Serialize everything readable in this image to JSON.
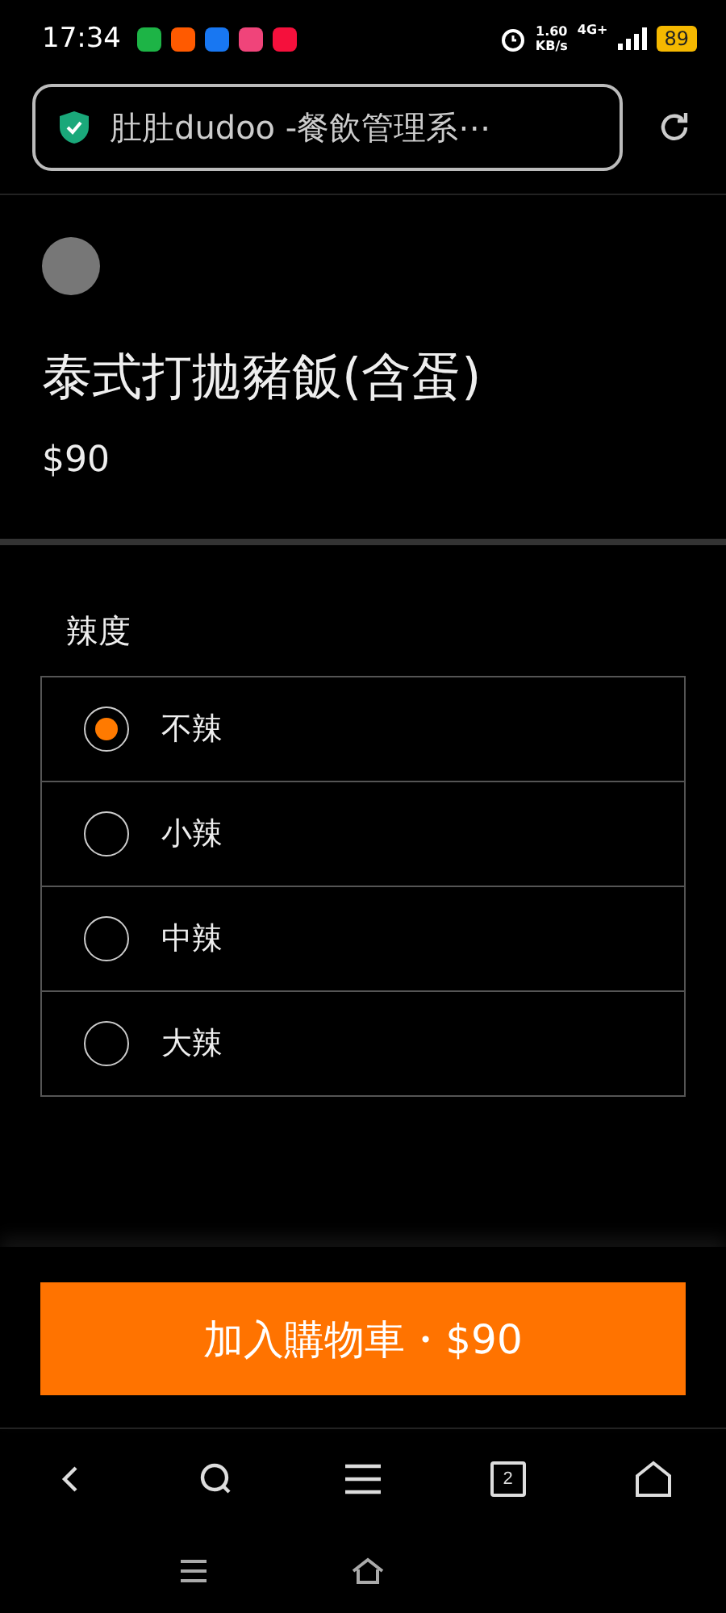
{
  "status_bar": {
    "time": "17:34",
    "apps": [
      {
        "color": "#1db446"
      },
      {
        "color": "#ff5a00"
      },
      {
        "color": "#1877f2"
      },
      {
        "color": "#f0447a"
      },
      {
        "color": "#f5103c"
      }
    ],
    "speed": "1.60",
    "speed_unit": "KB/s",
    "network": "4G+",
    "battery": "89"
  },
  "address_bar": {
    "title": "肚肚dudoo -餐飲管理系⋯"
  },
  "product": {
    "name": "泰式打拋豬飯(含蛋)",
    "price": "$90"
  },
  "option_group": {
    "title": "辣度",
    "options": [
      {
        "label": "不辣",
        "selected": true
      },
      {
        "label": "小辣",
        "selected": false
      },
      {
        "label": "中辣",
        "selected": false
      },
      {
        "label": "大辣",
        "selected": false
      }
    ]
  },
  "add_to_cart": {
    "label": "加入購物車・$90"
  },
  "browser_nav": {
    "tab_count": "2"
  }
}
